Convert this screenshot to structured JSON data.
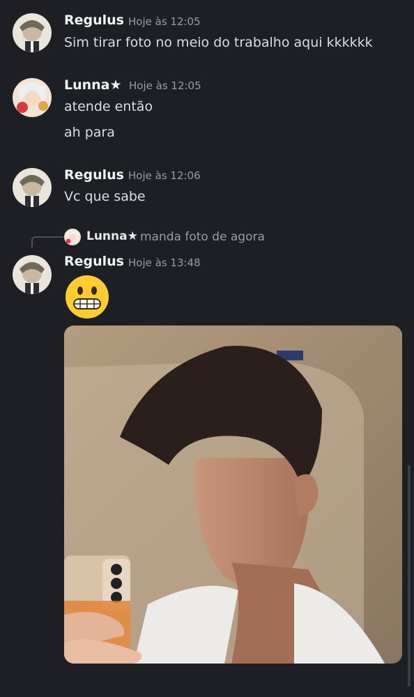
{
  "messages": [
    {
      "author": "Regulus",
      "time": "Hoje às 12:05",
      "lines": [
        "Sim tirar foto no meio do trabalho aqui kkkkkk"
      ]
    },
    {
      "author": "Lunna★",
      "time": "Hoje às 12:05",
      "lines": [
        "atende então",
        "ah para"
      ]
    },
    {
      "author": "Regulus",
      "time": "Hoje às 12:06",
      "lines": [
        "Vc que sabe"
      ]
    },
    {
      "author": "Regulus",
      "time": "Hoje às 13:48",
      "lines": [],
      "reply": {
        "author": "Lunna★",
        "text": "manda foto de agora"
      },
      "emoji": "grimacing-face",
      "attachment": "mirror-selfie-photo"
    }
  ],
  "colors": {
    "background": "#1e1f25",
    "name": "#f2f3f5",
    "muted": "#9a9ca6"
  }
}
